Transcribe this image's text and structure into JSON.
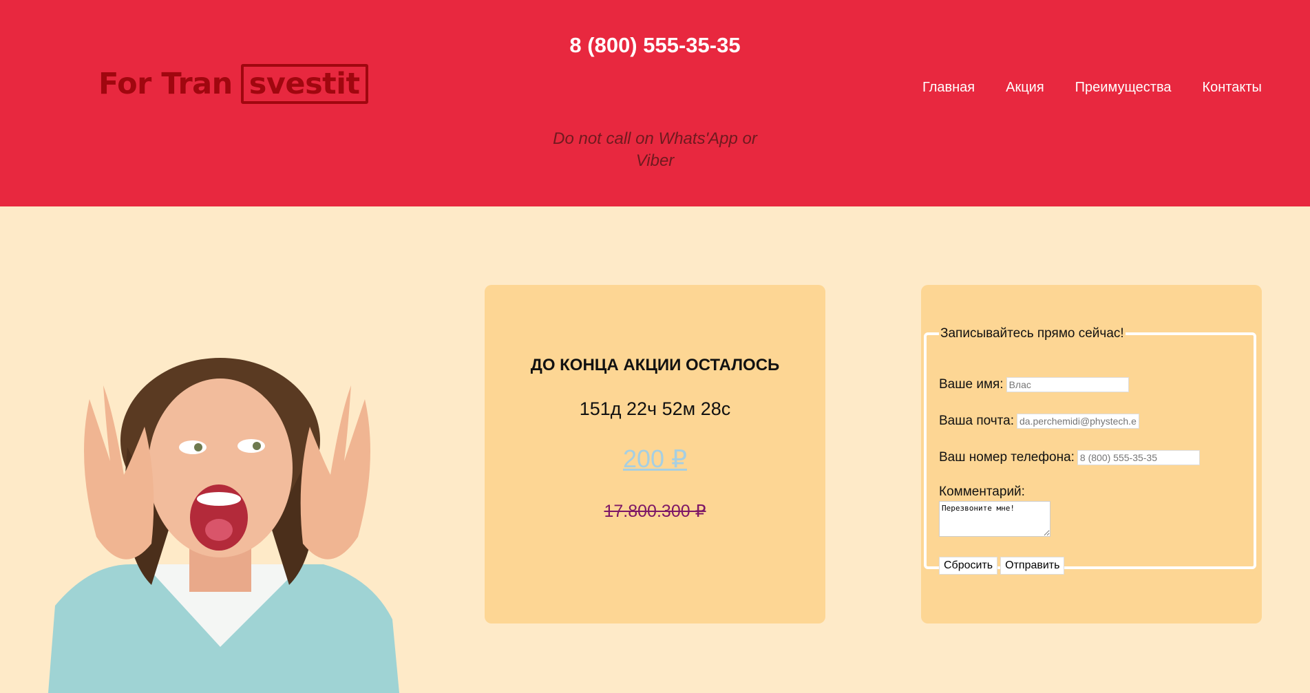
{
  "header": {
    "logo_text": "For Tran",
    "logo_box_text": "svestit",
    "phone": "8 (800) 555-35-35",
    "note": "Do not call on Whats'App or Viber",
    "nav": [
      "Главная",
      "Акция",
      "Преимущества",
      "Контакты"
    ]
  },
  "promo": {
    "title": "ДО КОНЦА АКЦИИ ОСТАЛОСЬ",
    "timer": "151д 22ч 52м 28с",
    "new_price": "200 ₽",
    "old_price": "17.800.300 ₽"
  },
  "form": {
    "legend": "Записывайтесь прямо сейчас!",
    "name_label": "Ваше имя:",
    "name_placeholder": "Влас",
    "email_label": "Ваша почта:",
    "email_placeholder": "da.perchemidi@phystech.edu",
    "phone_label": "Ваш номер телефона:",
    "phone_placeholder": "8 (800) 555-35-35",
    "comment_label": "Комментарий:",
    "comment_value": "Перезвоните мне!",
    "reset_label": "Сбросить",
    "submit_label": "Отправить"
  },
  "colors": {
    "header_bg": "#e8283f",
    "page_bg": "#feeac8",
    "card_bg": "#fdd694",
    "logo": "#a0070f"
  }
}
